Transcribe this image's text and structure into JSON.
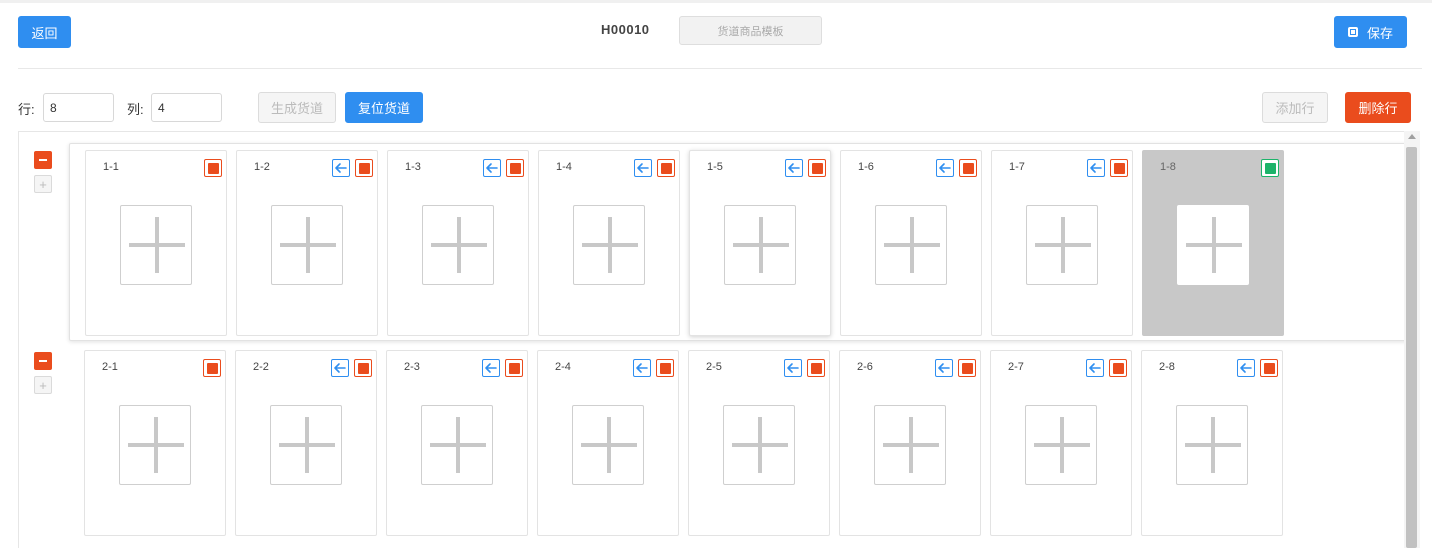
{
  "header": {
    "back_label": "返回",
    "code": "H00010",
    "template_placeholder": "货道商品模板",
    "save_label": "保存"
  },
  "controls": {
    "row_label": "行:",
    "row_value": "8",
    "col_label": "列:",
    "col_value": "4",
    "generate_label": "生成货道",
    "reset_label": "复位货道",
    "add_row_label": "添加行",
    "delete_row_label": "删除行"
  },
  "colors": {
    "primary": "#2f8ef0",
    "danger": "#ea4c1d",
    "success": "#1cb36a",
    "disabled_slot": "#c8c8c8"
  },
  "rows": [
    {
      "slots": [
        {
          "label": "1-1",
          "arrow": false,
          "status": "red"
        },
        {
          "label": "1-2",
          "arrow": true,
          "status": "red"
        },
        {
          "label": "1-3",
          "arrow": true,
          "status": "red"
        },
        {
          "label": "1-4",
          "arrow": true,
          "status": "red"
        },
        {
          "label": "1-5",
          "arrow": true,
          "status": "red",
          "hover": true
        },
        {
          "label": "1-6",
          "arrow": true,
          "status": "red"
        },
        {
          "label": "1-7",
          "arrow": true,
          "status": "red"
        },
        {
          "label": "1-8",
          "arrow": false,
          "status": "green",
          "disabled": true
        }
      ]
    },
    {
      "slots": [
        {
          "label": "2-1",
          "arrow": false,
          "status": "red"
        },
        {
          "label": "2-2",
          "arrow": true,
          "status": "red"
        },
        {
          "label": "2-3",
          "arrow": true,
          "status": "red"
        },
        {
          "label": "2-4",
          "arrow": true,
          "status": "red"
        },
        {
          "label": "2-5",
          "arrow": true,
          "status": "red"
        },
        {
          "label": "2-6",
          "arrow": true,
          "status": "red"
        },
        {
          "label": "2-7",
          "arrow": true,
          "status": "red"
        },
        {
          "label": "2-8",
          "arrow": true,
          "status": "red"
        }
      ]
    }
  ]
}
